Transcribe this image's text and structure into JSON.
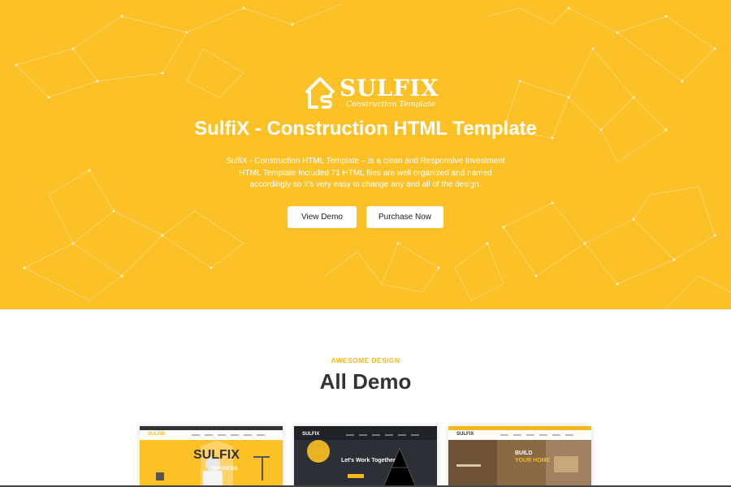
{
  "hero": {
    "logo_brand": "SULFIX",
    "logo_tagline": "Construction Template",
    "title": "SulfiX - Construction HTML Template",
    "description": "SulfiX - Construction HTML Template – is a clean and Responsive Investment HTML Template Included 71 HTML files are well organized and named accordingly so it's very easy to change any and all of the design.",
    "buttons": {
      "view_demo": "View Demo",
      "purchase_now": "Purchase Now"
    },
    "background_color": "#fcc127"
  },
  "demos": {
    "eyebrow": "AWESOME DESIGN",
    "title": "All Demo",
    "accent_color": "#f6b81a",
    "cards": [
      {
        "logo": "SULFIX",
        "headline": "SULFIX",
        "sub": "SERVICES"
      },
      {
        "logo": "SULFIX",
        "headline": "Let's Work Together"
      },
      {
        "logo": "SULFIX",
        "headline": "BUILD",
        "sub": "YOUR HOME"
      }
    ]
  }
}
